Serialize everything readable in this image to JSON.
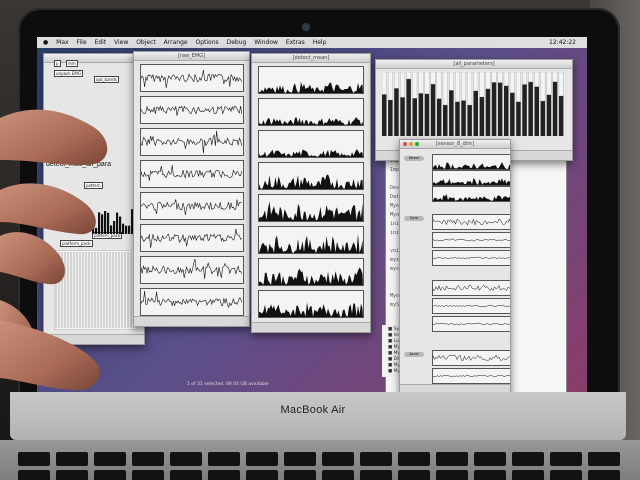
{
  "menubar": {
    "items": [
      "Max",
      "File",
      "Edit",
      "View",
      "Object",
      "Arrange",
      "Options",
      "Debug",
      "Window",
      "Extras",
      "Help"
    ],
    "clock": "12:42:22"
  },
  "windows": {
    "patcher": {
      "title": "",
      "overlay_lines": [
        "raw_EMG",
        "detect_mec_all_para"
      ],
      "objects": [
        "p",
        "mm",
        "unpack EMG",
        "pattern",
        "pattern_pack",
        "platform_pack",
        "opt_bands"
      ]
    },
    "raw_emg": {
      "title": "[raw_EMG]"
    },
    "detect_mean": {
      "title": "[detect_mean]"
    },
    "parameters": {
      "title": "[all_parameters]"
    },
    "sensor": {
      "title": "[sensor_8_dim]",
      "buttons": [
        "Direct",
        "Gyro",
        "Accel"
      ]
    }
  },
  "terminal": {
    "lines": [
      "Import",
      "Import",
      "",
      "DevPS",
      "DataAppl",
      "Myo",
      "Myo",
      "init",
      "init",
      "",
      "void",
      "mysc",
      "mysc",
      "",
      "",
      "Myo",
      "mySc"
    ]
  },
  "finder": {
    "rows": [
      "Symmtg",
      "Issi",
      "Luct_ST0",
      "Myo_Man_1",
      "Myo_Man_2",
      "DSC00125_2",
      "Myo_Man_Di",
      "Myo_Max_Ag"
    ]
  },
  "status_bar": "1 of 31 selected, 69.04 GB available",
  "laptop": {
    "brand": "MacBook Air"
  },
  "colors": {
    "screen_bg": "#5a4f8a",
    "window_bg": "#e6e6e6",
    "plot_bg": "#f4f4f4",
    "signal": "#111111"
  }
}
